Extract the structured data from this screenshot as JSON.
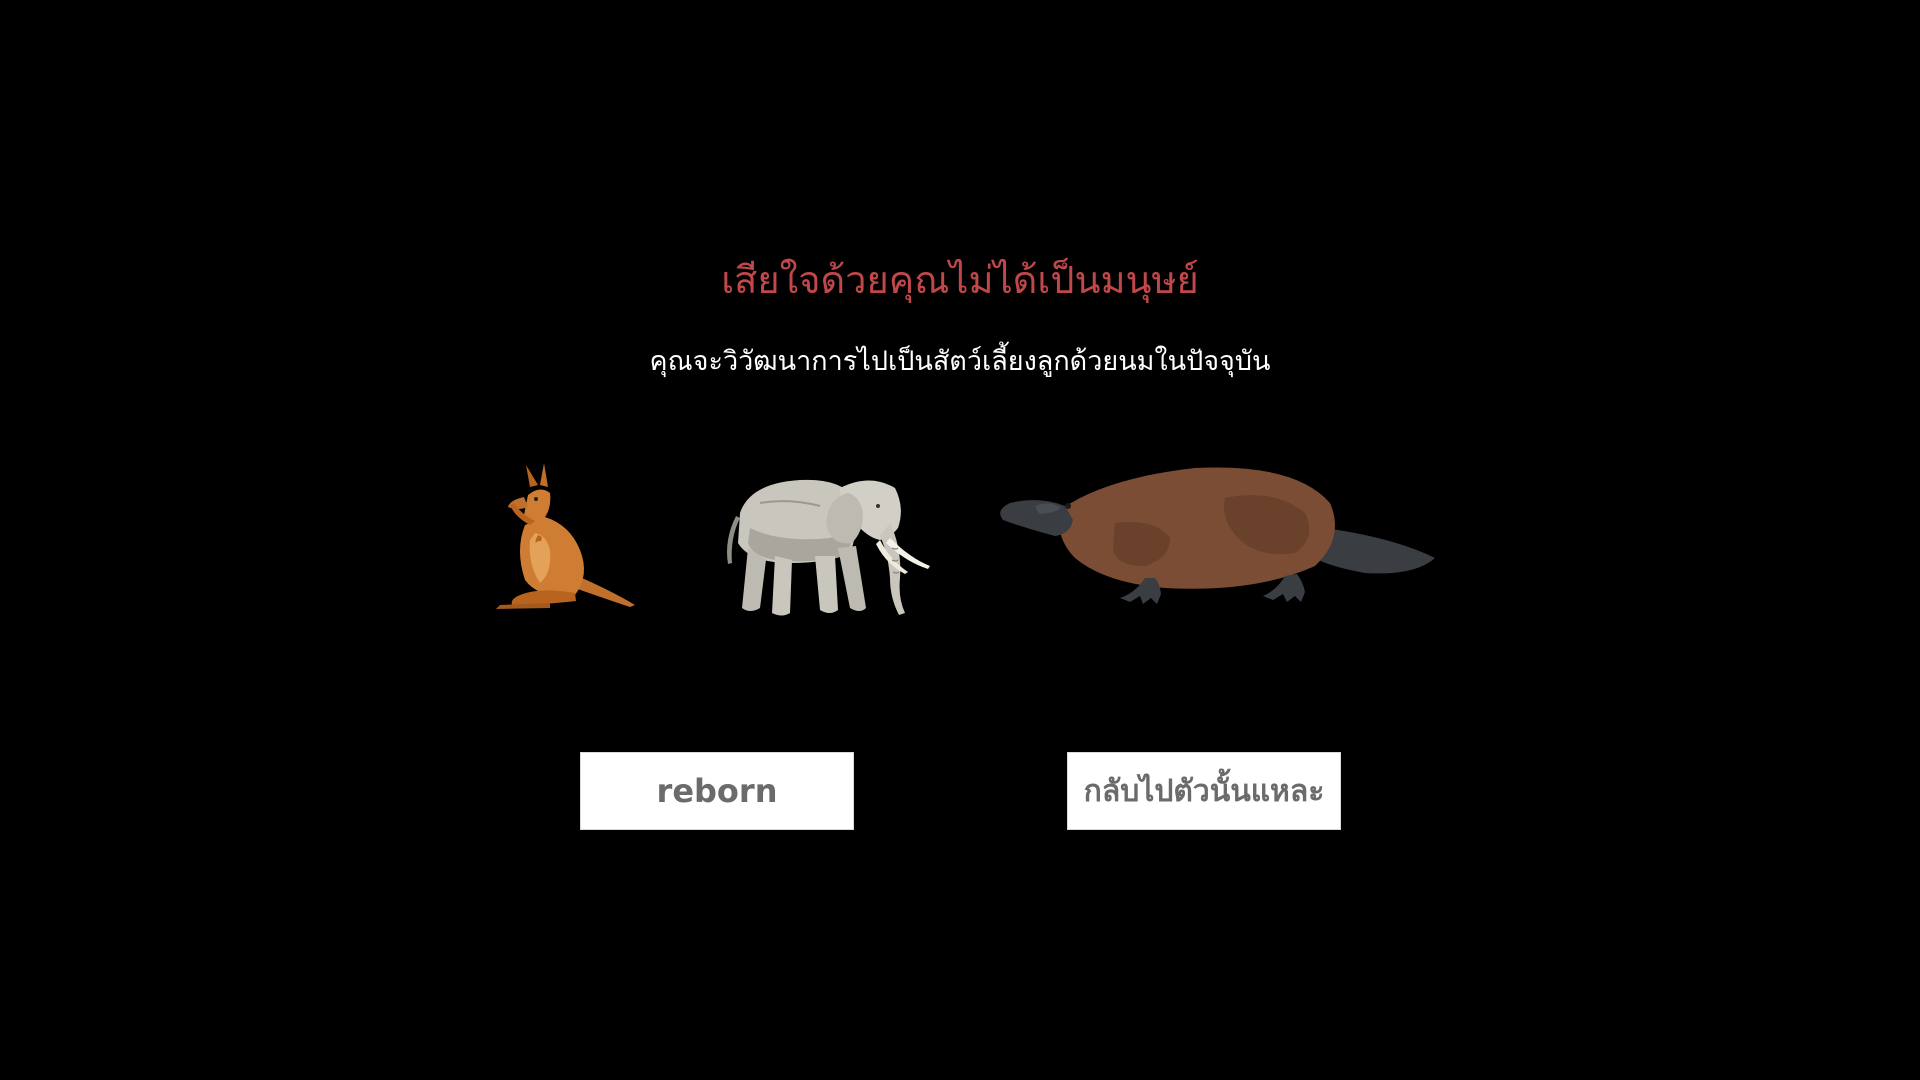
{
  "screen": {
    "headline": "เสียใจด้วยคุณไม่ได้เป็นมนุษย์",
    "subline": "คุณจะวิวัฒนาการไปเป็นสัตว์เลี้ยงลูกด้วยนมในปัจจุบัน"
  },
  "animals": [
    {
      "icon": "kangaroo-icon"
    },
    {
      "icon": "elephant-icon"
    },
    {
      "icon": "platypus-icon"
    }
  ],
  "buttons": {
    "reborn_label": "reborn",
    "back_label": "กลับไปตัวนั้นแหละ"
  },
  "colors": {
    "background": "#000000",
    "headline": "#c0474a",
    "subline": "#ffffff",
    "button_bg": "#ffffff",
    "button_text": "#6b6b6b"
  }
}
